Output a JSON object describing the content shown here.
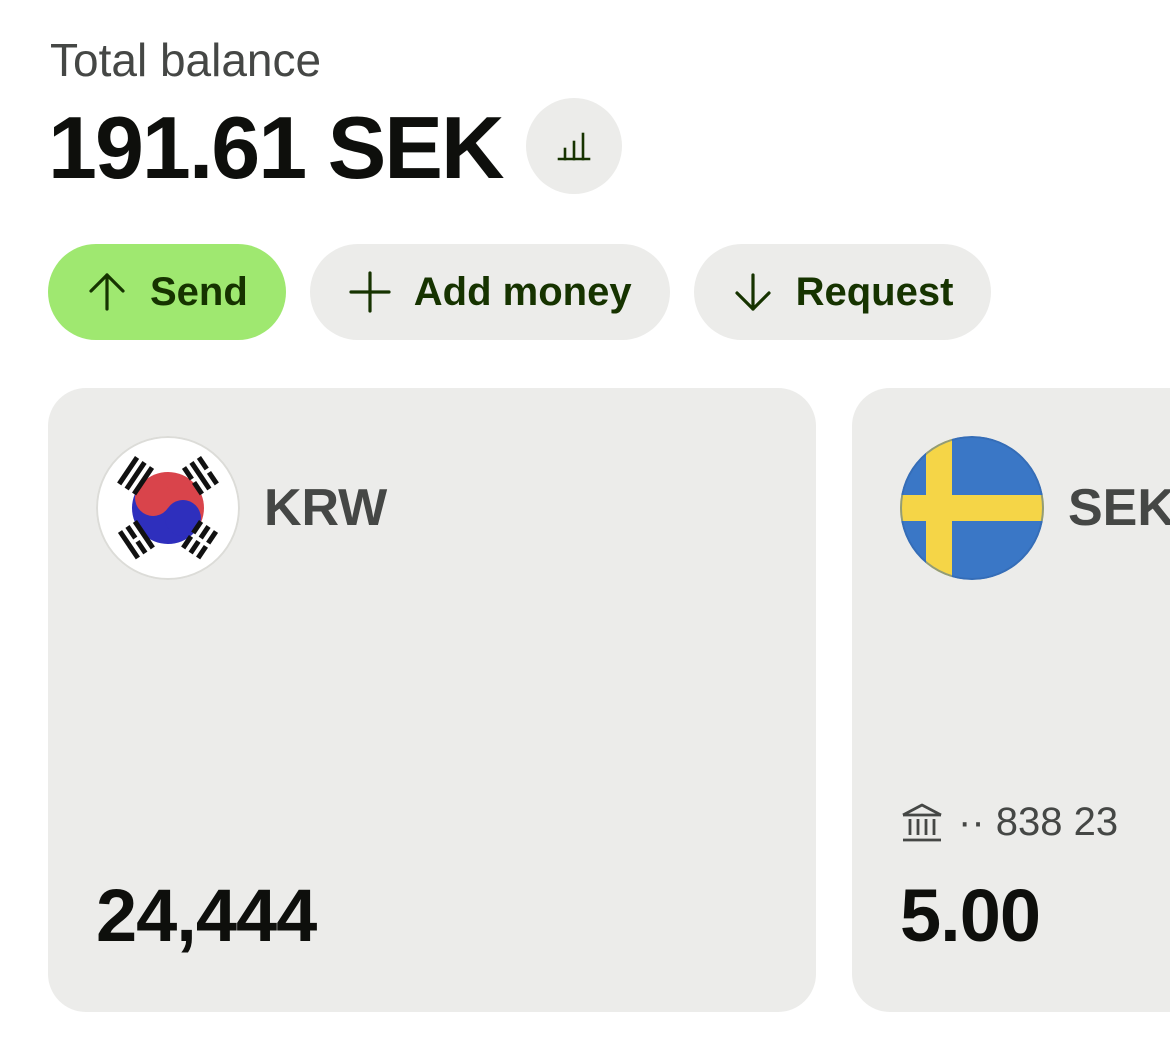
{
  "header": {
    "total_label": "Total balance",
    "total_amount": "191.61 SEK",
    "insights_icon": "bar-chart-icon"
  },
  "actions": [
    {
      "label": "Send",
      "icon": "arrow-up-icon",
      "primary": true
    },
    {
      "label": "Add money",
      "icon": "plus-icon",
      "primary": false
    },
    {
      "label": "Request",
      "icon": "arrow-down-icon",
      "primary": false
    }
  ],
  "cards": [
    {
      "currency": "KRW",
      "flag": "south-korea-flag-icon",
      "balance": "24,444"
    },
    {
      "currency": "SEK",
      "flag": "sweden-flag-icon",
      "account": "·· 838 23",
      "account_icon": "bank-icon",
      "balance": "5.00"
    }
  ],
  "colors": {
    "primary_button": "#9fe870",
    "secondary_button": "#ececea",
    "button_text": "#163300",
    "card_bg": "#ececea"
  }
}
